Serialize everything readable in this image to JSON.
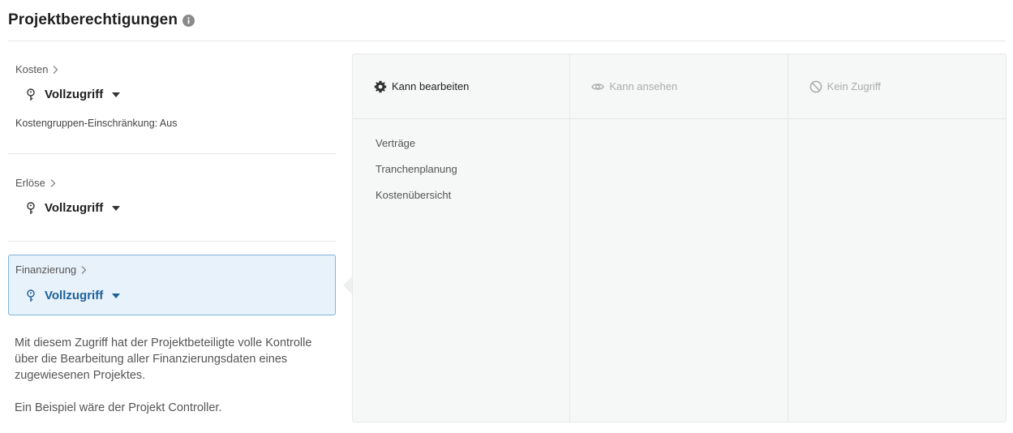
{
  "header": {
    "title": "Projektberechtigungen",
    "info_icon": "info-icon"
  },
  "sections": [
    {
      "label": "Kosten",
      "access": "Vollzugriff",
      "restriction": "Kostengruppen-Einschränkung: Aus"
    },
    {
      "label": "Erlöse",
      "access": "Vollzugriff"
    },
    {
      "label": "Finanzierung",
      "access": "Vollzugriff",
      "selected": true
    }
  ],
  "description": {
    "paragraph1": "Mit diesem Zugriff hat der Projektbeteiligte volle Kontrolle über die Bearbeitung aller Finanzierungsdaten eines zugewiesenen Projektes.",
    "paragraph2": "Ein Beispiel wäre der Projekt Controller."
  },
  "permissions": {
    "columns": [
      {
        "label": "Kann bearbeiten",
        "icon": "gear-icon",
        "items": [
          "Verträge",
          "Tranchenplanung",
          "Kostenübersicht"
        ]
      },
      {
        "label": "Kann ansehen",
        "icon": "eye-icon",
        "items": []
      },
      {
        "label": "Kein Zugriff",
        "icon": "no-access-icon",
        "items": []
      }
    ]
  },
  "colors": {
    "accent": "#1e5f99",
    "selected_bg": "#e8f2fb",
    "selected_border": "#7fb3dc",
    "panel_bg": "#f6f7f7"
  }
}
